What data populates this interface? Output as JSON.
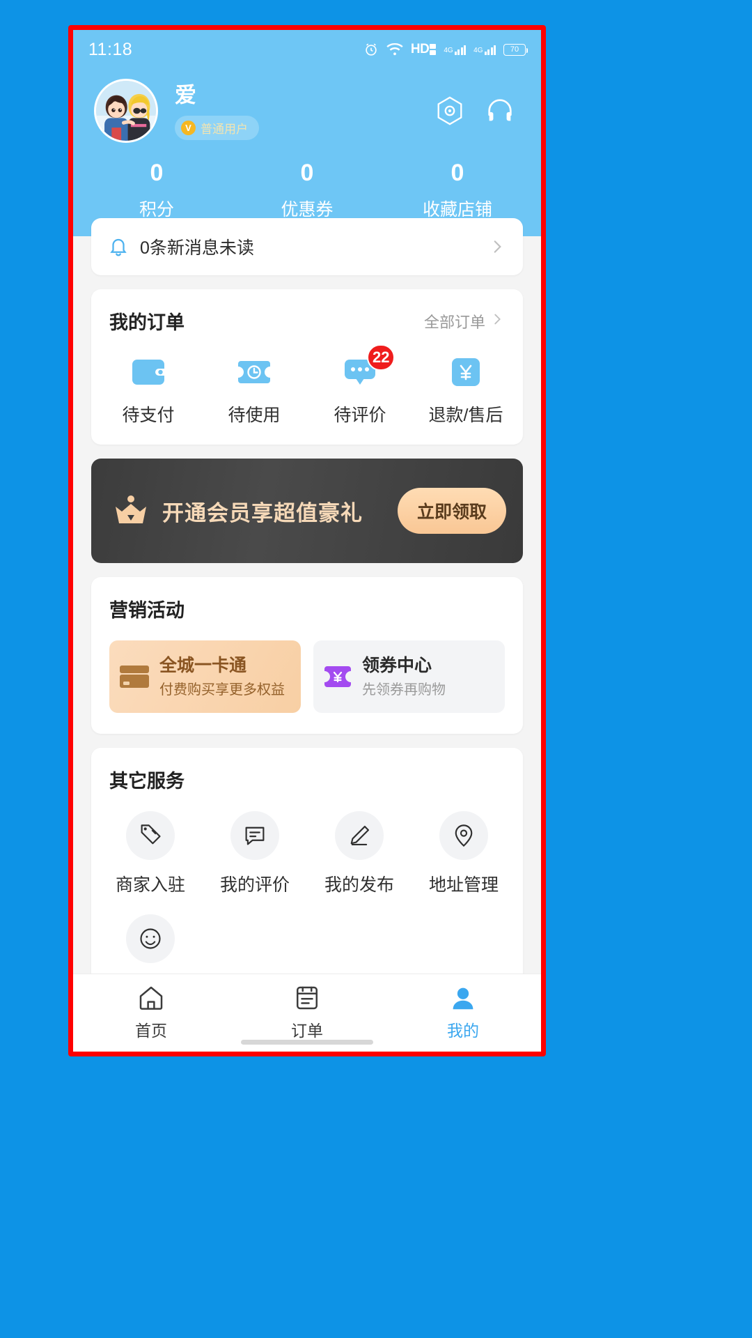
{
  "status_bar": {
    "time": "11:18",
    "hd_label": "HD",
    "sim1_label": "4G",
    "sim2_label": "4G",
    "battery_level": "70",
    "icons": [
      "alarm-icon",
      "wifi-icon",
      "hd-icon",
      "signal-icon",
      "signal-icon",
      "battery-icon"
    ]
  },
  "header": {
    "username": "爱",
    "badge_icon_char": "V",
    "badge_label": "普通用户",
    "scan_icon": "scan-icon",
    "service_icon": "headset-icon",
    "stats": [
      {
        "value": "0",
        "label": "积分"
      },
      {
        "value": "0",
        "label": "优惠券"
      },
      {
        "value": "0",
        "label": "收藏店铺"
      }
    ]
  },
  "message_bar": {
    "text": "0条新消息未读",
    "bell_icon": "bell-icon",
    "chevron": "chevron-right-icon"
  },
  "orders": {
    "title": "我的订单",
    "more_label": "全部订单",
    "items": [
      {
        "label": "待支付",
        "icon": "wallet-icon",
        "badge": ""
      },
      {
        "label": "待使用",
        "icon": "ticket-clock-icon",
        "badge": ""
      },
      {
        "label": "待评价",
        "icon": "comment-icon",
        "badge": "22"
      },
      {
        "label": "退款/售后",
        "icon": "refund-yuan-icon",
        "badge": ""
      }
    ]
  },
  "vip_banner": {
    "text": "开通会员享超值豪礼",
    "button_label": "立即领取",
    "crown_icon": "crown-icon"
  },
  "marketing": {
    "title": "营销活动",
    "cards": [
      {
        "title": "全城一卡通",
        "subtitle": "付费购买享更多权益",
        "icon": "card-icon"
      },
      {
        "title": "领券中心",
        "subtitle": "先领券再购物",
        "icon": "coupon-icon"
      }
    ]
  },
  "other_services": {
    "title": "其它服务",
    "items": [
      {
        "label": "商家入驻",
        "icon": "tags-icon"
      },
      {
        "label": "我的评价",
        "icon": "comment-lines-icon"
      },
      {
        "label": "我的发布",
        "icon": "pencil-icon"
      },
      {
        "label": "地址管理",
        "icon": "location-pin-icon"
      },
      {
        "label": "",
        "icon": "face-smile-icon"
      }
    ]
  },
  "tabbar": {
    "items": [
      {
        "label": "首页",
        "icon": "home-icon",
        "active": false
      },
      {
        "label": "订单",
        "icon": "order-list-icon",
        "active": false
      },
      {
        "label": "我的",
        "icon": "person-icon",
        "active": true
      }
    ]
  },
  "colors": {
    "brand_blue": "#6ec6f5",
    "page_bg_blue": "#0d93e6",
    "accent_blue": "#3ba7ef",
    "badge_red": "#ef1d1d",
    "vip_gold": "#f6d9b8",
    "frame_red": "#ff0000"
  }
}
